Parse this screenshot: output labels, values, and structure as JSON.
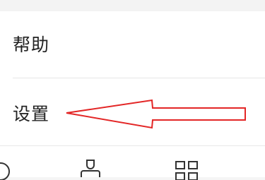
{
  "menu": {
    "items": [
      {
        "id": "help",
        "label": "帮助"
      },
      {
        "id": "settings",
        "label": "设置"
      }
    ]
  },
  "annotation": {
    "arrow_color": "#e32626",
    "target": "settings"
  },
  "tabbar": {
    "icons": [
      "circle-icon",
      "person-icon",
      "grid-icon"
    ]
  },
  "colors": {
    "background": "#f5f5f5",
    "card": "#ffffff",
    "text": "#222222",
    "divider": "#e6e6e6"
  }
}
